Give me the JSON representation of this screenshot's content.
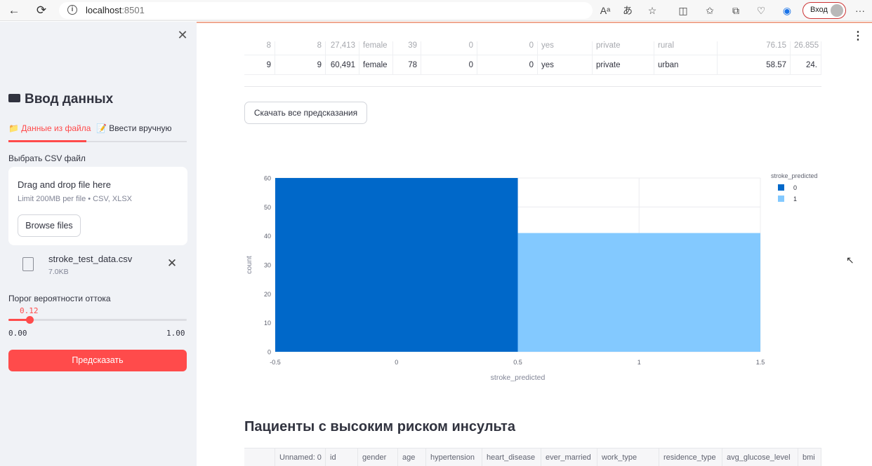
{
  "browser": {
    "url_host": "localhost",
    "url_port": ":8501",
    "login_label": "Вход"
  },
  "sidebar": {
    "title": "Ввод данных",
    "tabs": [
      {
        "label": "📁 Данные из файла",
        "active": true
      },
      {
        "label": "📝 Ввести вручную",
        "active": false
      }
    ],
    "uploader": {
      "label": "Выбрать CSV файл",
      "drop_text": "Drag and drop file here",
      "limit_text": "Limit 200MB per file • CSV, XLSX",
      "browse_label": "Browse files"
    },
    "file": {
      "name": "stroke_test_data.csv",
      "size": "7.0KB"
    },
    "slider": {
      "label": "Порог вероятности оттока",
      "value": 0.12,
      "value_text": "0.12",
      "min_text": "0.00",
      "max_text": "1.00",
      "min": 0,
      "max": 1
    },
    "predict_label": "Предсказать"
  },
  "main": {
    "table_rows": [
      {
        "idx": "8",
        "unnamed": "8",
        "id": "27,413",
        "gender": "female",
        "age": "39",
        "hypertension": "0",
        "heart_disease": "0",
        "ever_married": "yes",
        "work_type": "private",
        "residence_type": "rural",
        "avg_glucose_level": "76.15",
        "bmi": "26.855"
      },
      {
        "idx": "9",
        "unnamed": "9",
        "id": "60,491",
        "gender": "female",
        "age": "78",
        "hypertension": "0",
        "heart_disease": "0",
        "ever_married": "yes",
        "work_type": "private",
        "residence_type": "urban",
        "avg_glucose_level": "58.57",
        "bmi": "24."
      }
    ],
    "download_label": "Скачать все предсказания",
    "section_title": "Пациенты с высоким риском инсульта",
    "bottom_headers": [
      "",
      "Unnamed: 0",
      "id",
      "gender",
      "age",
      "hypertension",
      "heart_disease",
      "ever_married",
      "work_type",
      "residence_type",
      "avg_glucose_level",
      "bmi"
    ]
  },
  "colors": {
    "accent": "#ff4b4b",
    "bar0": "#0068c9",
    "bar1": "#83c9ff"
  },
  "chart_data": {
    "type": "bar",
    "xlabel": "stroke_predicted",
    "ylabel": "count",
    "legend_title": "stroke_predicted",
    "legend_position": "top-right",
    "series": [
      {
        "name": "0",
        "x_range": [
          -0.5,
          0.5
        ],
        "value": 60,
        "color": "#0068c9"
      },
      {
        "name": "1",
        "x_range": [
          0.5,
          1.5
        ],
        "value": 41,
        "color": "#83c9ff"
      }
    ],
    "xlim": [
      -0.5,
      1.5
    ],
    "ylim": [
      0,
      60
    ],
    "x_ticks": [
      -0.5,
      0,
      0.5,
      1,
      1.5
    ],
    "x_tick_labels": [
      "-0.5",
      "0",
      "0.5",
      "1",
      "1.5"
    ],
    "y_ticks": [
      0,
      10,
      20,
      30,
      40,
      50,
      60
    ],
    "grid": true
  }
}
